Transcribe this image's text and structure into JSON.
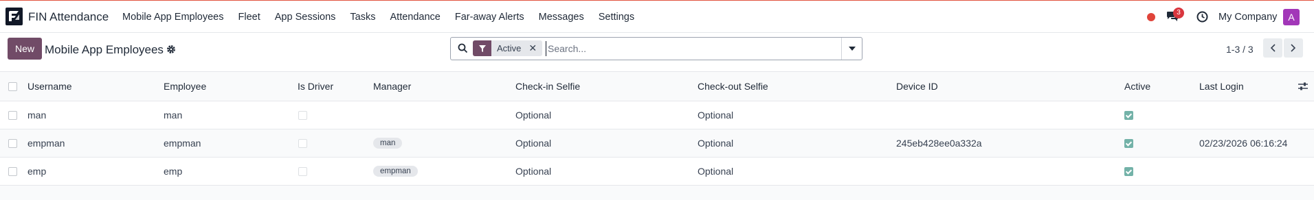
{
  "navbar": {
    "app_name": "FIN Attendance",
    "menu": [
      "Mobile App Employees",
      "Fleet",
      "App Sessions",
      "Tasks",
      "Attendance",
      "Far-away Alerts",
      "Messages",
      "Settings"
    ],
    "chat_count": "3",
    "company": "My Company",
    "avatar_letter": "A"
  },
  "control": {
    "new_label": "New",
    "title": "Mobile App Employees",
    "facet_value": "Active",
    "search_placeholder": "Search...",
    "pager": "1-3 / 3"
  },
  "table": {
    "columns": [
      "Username",
      "Employee",
      "Is Driver",
      "Manager",
      "Check-in Selfie",
      "Check-out Selfie",
      "Device ID",
      "Active",
      "Last Login"
    ],
    "rows": [
      {
        "username": "man",
        "employee": "man",
        "is_driver": false,
        "manager": "",
        "checkin": "Optional",
        "checkout": "Optional",
        "device_id": "",
        "active": true,
        "last_login": ""
      },
      {
        "username": "empman",
        "employee": "empman",
        "is_driver": false,
        "manager": "man",
        "checkin": "Optional",
        "checkout": "Optional",
        "device_id": "245eb428ee0a332a",
        "active": true,
        "last_login": "02/23/2026 06:16:24"
      },
      {
        "username": "emp",
        "employee": "emp",
        "is_driver": false,
        "manager": "empman",
        "checkin": "Optional",
        "checkout": "Optional",
        "device_id": "",
        "active": true,
        "last_login": ""
      }
    ]
  },
  "colors": {
    "brand": "#714b67",
    "active_check": "#73b2a8",
    "notification_red": "#d9363e",
    "avatar": "#a237b8"
  },
  "icons": [
    "app-logo-icon",
    "red-dot-icon",
    "chat-icon",
    "clock-icon",
    "gear-icon",
    "search-icon",
    "filter-icon",
    "close-icon",
    "chevron-down-icon",
    "chevron-left-icon",
    "chevron-right-icon",
    "column-settings-icon"
  ]
}
